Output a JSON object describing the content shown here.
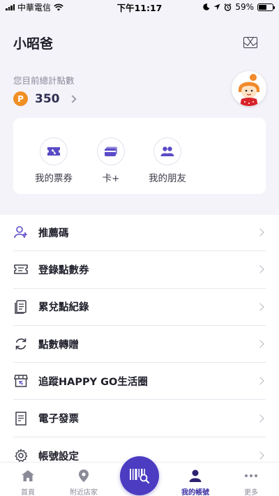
{
  "status_bar": {
    "carrier": "中華電信",
    "time": "下午11:17",
    "battery_percent": "59%",
    "battery_level": 0.59
  },
  "header": {
    "user_name": "小昭爸",
    "mail_icon": "mail-icon"
  },
  "points": {
    "label": "您目前總計點數",
    "badge": "P",
    "value": "350"
  },
  "quick_actions": [
    {
      "label": "我的票券",
      "icon": "ticket-icon"
    },
    {
      "label": "卡+",
      "icon": "card-icon"
    },
    {
      "label": "我的朋友",
      "icon": "friends-icon"
    }
  ],
  "menu": [
    {
      "label": "推薦碼",
      "icon": "add-user-icon"
    },
    {
      "label": "登錄點數券",
      "icon": "coupon-icon"
    },
    {
      "label": "累兌點紀錄",
      "icon": "record-icon"
    },
    {
      "label": "點數轉贈",
      "icon": "transfer-icon"
    },
    {
      "label": "追蹤HAPPY GO生活圈",
      "icon": "store-icon"
    },
    {
      "label": "電子發票",
      "icon": "invoice-icon"
    },
    {
      "label": "帳號設定",
      "icon": "gear-icon"
    }
  ],
  "tabbar": {
    "tabs": [
      {
        "label": "首頁",
        "icon": "home-icon"
      },
      {
        "label": "附近店家",
        "icon": "location-pin-icon"
      },
      {
        "label": "我的帳號",
        "icon": "person-icon",
        "active": true
      },
      {
        "label": "更多",
        "icon": "more-dots-icon"
      }
    ],
    "center_icon": "barcode-scan-icon"
  },
  "colors": {
    "accent": "#4b3cc2",
    "icon_purple": "#5a4bc8",
    "points_badge": "#f08f24",
    "background_top": "#f4f3fa"
  }
}
